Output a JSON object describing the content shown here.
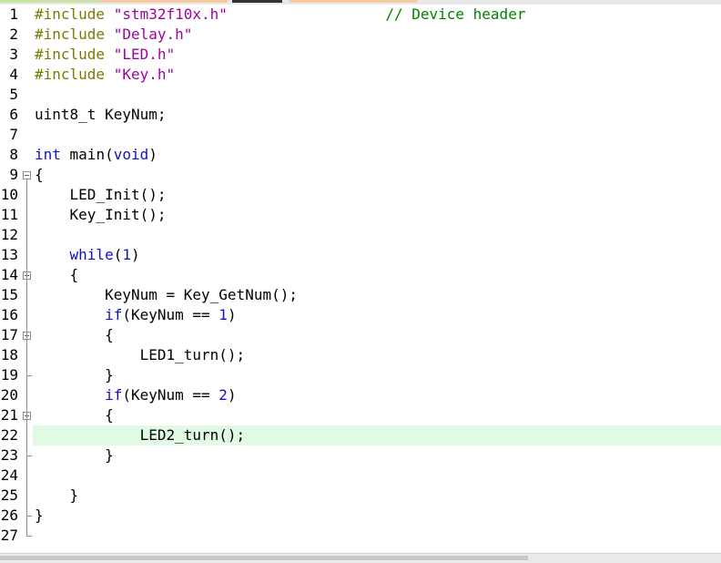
{
  "colors": {
    "background": "#ffffff",
    "current_line_highlight": "#e0fae4",
    "preprocessor": "#7a7a00",
    "string": "#a000a0",
    "keyword": "#1010c8",
    "comment": "#008000"
  },
  "current_line": 22,
  "lines": [
    {
      "n": "1",
      "tokens": [
        {
          "t": "pp",
          "v": "#include "
        },
        {
          "t": "str",
          "v": "\"stm32f10x.h\""
        },
        {
          "t": "tx",
          "v": "                  "
        },
        {
          "t": "cmt",
          "v": "// Device header"
        }
      ]
    },
    {
      "n": "2",
      "tokens": [
        {
          "t": "pp",
          "v": "#include "
        },
        {
          "t": "str",
          "v": "\"Delay.h\""
        }
      ]
    },
    {
      "n": "3",
      "tokens": [
        {
          "t": "pp",
          "v": "#include "
        },
        {
          "t": "str",
          "v": "\"LED.h\""
        }
      ]
    },
    {
      "n": "4",
      "tokens": [
        {
          "t": "pp",
          "v": "#include "
        },
        {
          "t": "str",
          "v": "\"Key.h\""
        }
      ]
    },
    {
      "n": "5",
      "tokens": []
    },
    {
      "n": "6",
      "tokens": [
        {
          "t": "tx",
          "v": "uint8_t KeyNum;"
        }
      ]
    },
    {
      "n": "7",
      "tokens": []
    },
    {
      "n": "8",
      "tokens": [
        {
          "t": "kw",
          "v": "int"
        },
        {
          "t": "tx",
          "v": " main("
        },
        {
          "t": "kw",
          "v": "void"
        },
        {
          "t": "tx",
          "v": ")"
        }
      ]
    },
    {
      "n": "9",
      "tokens": [
        {
          "t": "tx",
          "v": "{"
        }
      ]
    },
    {
      "n": "10",
      "tokens": [
        {
          "t": "tx",
          "v": "    LED_Init();"
        }
      ]
    },
    {
      "n": "11",
      "tokens": [
        {
          "t": "tx",
          "v": "    Key_Init();"
        }
      ]
    },
    {
      "n": "12",
      "tokens": []
    },
    {
      "n": "13",
      "tokens": [
        {
          "t": "tx",
          "v": "    "
        },
        {
          "t": "kw",
          "v": "while"
        },
        {
          "t": "tx",
          "v": "("
        },
        {
          "t": "num",
          "v": "1"
        },
        {
          "t": "tx",
          "v": ")"
        }
      ]
    },
    {
      "n": "14",
      "tokens": [
        {
          "t": "tx",
          "v": "    {"
        }
      ]
    },
    {
      "n": "15",
      "tokens": [
        {
          "t": "tx",
          "v": "        KeyNum = Key_GetNum();"
        }
      ]
    },
    {
      "n": "16",
      "tokens": [
        {
          "t": "tx",
          "v": "        "
        },
        {
          "t": "kw",
          "v": "if"
        },
        {
          "t": "tx",
          "v": "(KeyNum == "
        },
        {
          "t": "num",
          "v": "1"
        },
        {
          "t": "tx",
          "v": ")"
        }
      ]
    },
    {
      "n": "17",
      "tokens": [
        {
          "t": "tx",
          "v": "        {"
        }
      ]
    },
    {
      "n": "18",
      "tokens": [
        {
          "t": "tx",
          "v": "            LED1_turn();"
        }
      ]
    },
    {
      "n": "19",
      "tokens": [
        {
          "t": "tx",
          "v": "        }"
        }
      ]
    },
    {
      "n": "20",
      "tokens": [
        {
          "t": "tx",
          "v": "        "
        },
        {
          "t": "kw",
          "v": "if"
        },
        {
          "t": "tx",
          "v": "(KeyNum == "
        },
        {
          "t": "num",
          "v": "2"
        },
        {
          "t": "tx",
          "v": ")"
        }
      ]
    },
    {
      "n": "21",
      "tokens": [
        {
          "t": "tx",
          "v": "        {"
        }
      ]
    },
    {
      "n": "22",
      "tokens": [
        {
          "t": "tx",
          "v": "            LED2_turn();"
        }
      ]
    },
    {
      "n": "23",
      "tokens": [
        {
          "t": "tx",
          "v": "        }"
        }
      ]
    },
    {
      "n": "24",
      "tokens": []
    },
    {
      "n": "25",
      "tokens": [
        {
          "t": "tx",
          "v": "    }"
        }
      ]
    },
    {
      "n": "26",
      "tokens": [
        {
          "t": "tx",
          "v": "}"
        }
      ]
    },
    {
      "n": "27",
      "tokens": []
    }
  ],
  "fold_markers": [
    "9",
    "14",
    "17",
    "21"
  ],
  "fold_ends": [
    "19",
    "23",
    "26",
    "27"
  ]
}
